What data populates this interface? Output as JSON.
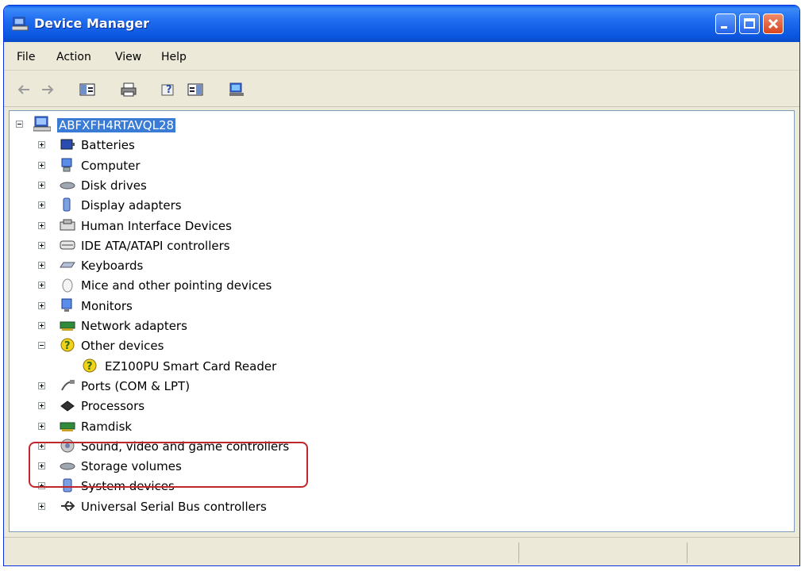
{
  "window": {
    "title": "Device Manager",
    "controls": [
      "minimize-button",
      "maximize-button",
      "close-button"
    ]
  },
  "menu": [
    "File",
    "Action",
    "View",
    "Help"
  ],
  "toolbar": {
    "icons": [
      "back-arrow-icon",
      "forward-arrow-icon",
      "show-hide-console-tree-icon",
      "print-icon",
      "help-icon",
      "show-hide-action-pane-icon",
      "scan-hardware-icon"
    ]
  },
  "tree": {
    "root": "ABFXFH4RTAVQL28",
    "categories": [
      {
        "label": "Batteries",
        "icon": "battery-icon",
        "expanded": false
      },
      {
        "label": "Computer",
        "icon": "computer-icon",
        "expanded": false
      },
      {
        "label": "Disk drives",
        "icon": "disk-drive-icon",
        "expanded": false
      },
      {
        "label": "Display adapters",
        "icon": "display-adapter-icon",
        "expanded": false
      },
      {
        "label": "Human Interface Devices",
        "icon": "hid-icon",
        "expanded": false
      },
      {
        "label": "IDE ATA/ATAPI controllers",
        "icon": "ide-controller-icon",
        "expanded": false
      },
      {
        "label": "Keyboards",
        "icon": "keyboard-icon",
        "expanded": false
      },
      {
        "label": "Mice and other pointing devices",
        "icon": "mouse-icon",
        "expanded": false
      },
      {
        "label": "Monitors",
        "icon": "monitor-icon",
        "expanded": false
      },
      {
        "label": "Network adapters",
        "icon": "network-adapter-icon",
        "expanded": false
      },
      {
        "label": "Other devices",
        "icon": "unknown-device-icon",
        "expanded": true,
        "children": [
          {
            "label": "EZ100PU Smart Card Reader",
            "icon": "warning-device-icon"
          }
        ]
      },
      {
        "label": "Ports (COM & LPT)",
        "icon": "port-icon",
        "expanded": false
      },
      {
        "label": "Processors",
        "icon": "processor-icon",
        "expanded": false
      },
      {
        "label": "Ramdisk",
        "icon": "ramdisk-icon",
        "expanded": false
      },
      {
        "label": "Sound, video and game controllers",
        "icon": "sound-icon",
        "expanded": false
      },
      {
        "label": "Storage volumes",
        "icon": "storage-volume-icon",
        "expanded": false
      },
      {
        "label": "System devices",
        "icon": "system-device-icon",
        "expanded": false
      },
      {
        "label": "Universal Serial Bus controllers",
        "icon": "usb-icon",
        "expanded": false
      }
    ]
  },
  "colors": {
    "titlebar": "#0b55de",
    "selection": "#3a7bd5",
    "highlight_border": "#c0272d"
  }
}
